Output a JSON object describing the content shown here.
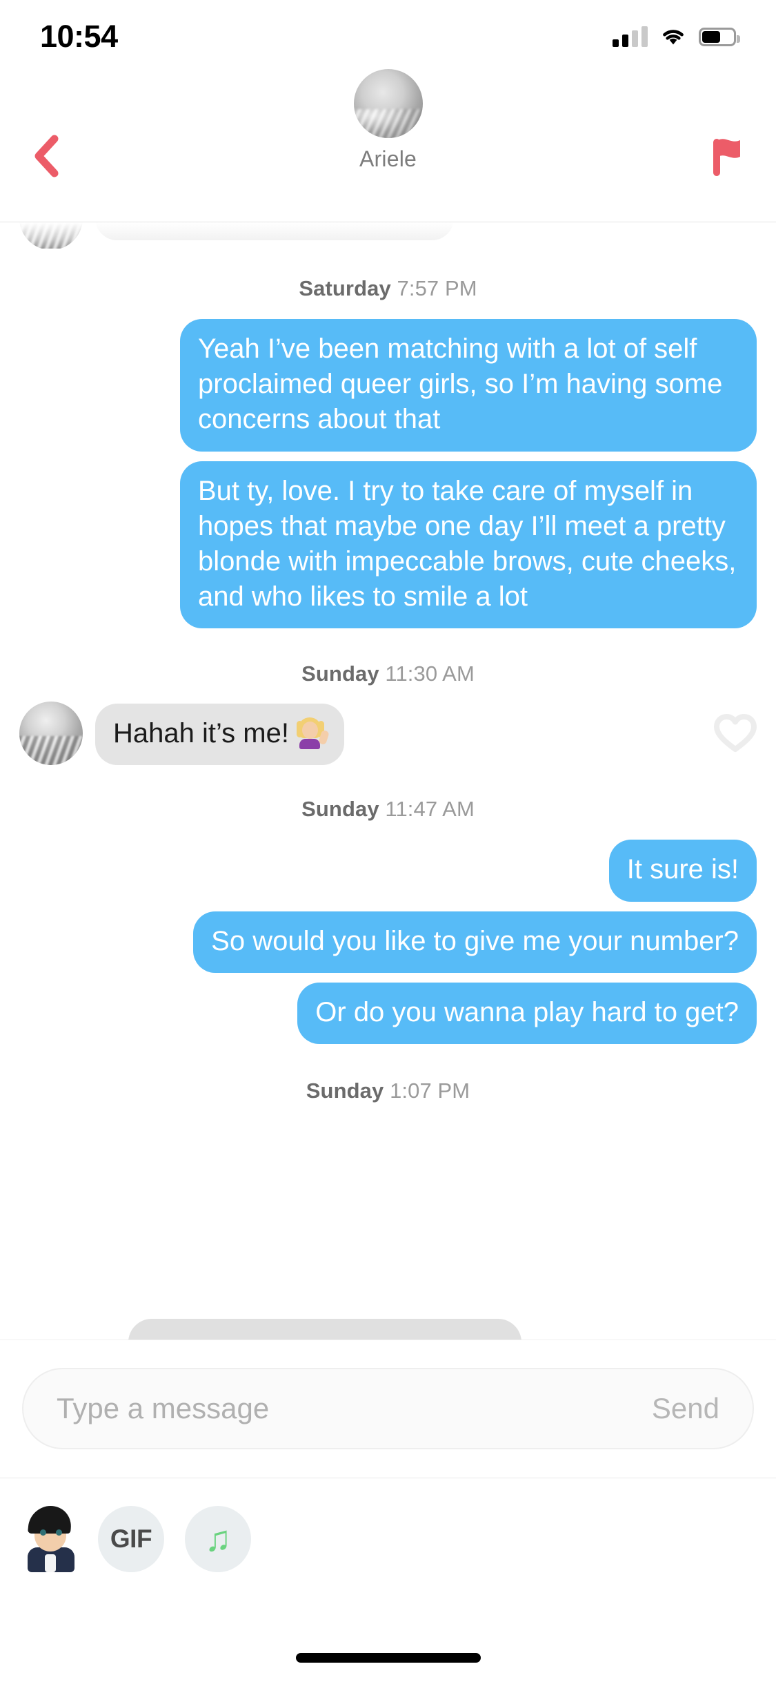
{
  "status_bar": {
    "time": "10:54",
    "signal_icon": "cellular-signal-icon",
    "wifi_icon": "wifi-icon",
    "battery_icon": "battery-icon",
    "battery_level_percent": 55
  },
  "header": {
    "back_icon": "chevron-left-icon",
    "report_icon": "flag-icon",
    "avatar_icon": "match-avatar",
    "name": "Ariele",
    "accent_color": "#ec5c68"
  },
  "thread": {
    "bubble_out_color": "#57bbf7",
    "bubble_in_color": "#e4e4e4",
    "groups": [
      {
        "day": "Saturday",
        "time": "7:57 PM",
        "messages": [
          {
            "side": "out",
            "text": "Yeah I’ve been matching with a lot of self proclaimed queer girls, so I’m having some concerns about that"
          },
          {
            "side": "out",
            "text": "But ty, love. I try to take care of myself in hopes that maybe one day I’ll meet a pretty blonde with impeccable brows, cute cheeks, and who likes to smile a lot"
          }
        ]
      },
      {
        "day": "Sunday",
        "time": "11:30 AM",
        "messages": [
          {
            "side": "in",
            "text": "Hahah it’s me!",
            "emoji": "💁‍♀️",
            "has_avatar": true,
            "like_icon": "heart-outline-icon"
          }
        ]
      },
      {
        "day": "Sunday",
        "time": "11:47 AM",
        "messages": [
          {
            "side": "out",
            "text": "It sure is!"
          },
          {
            "side": "out",
            "text": "So would you like to give me your number?"
          },
          {
            "side": "out",
            "text": "Or do you wanna play hard to get?"
          }
        ]
      },
      {
        "day": "Sunday",
        "time": "1:07 PM",
        "messages": []
      }
    ]
  },
  "composer": {
    "placeholder": "Type a message",
    "value": "",
    "send_label": "Send"
  },
  "toolbar": {
    "bitmoji_icon": "bitmoji-avatar-icon",
    "gif_label": "GIF",
    "gif_icon": "gif-icon",
    "music_icon": "music-note-icon",
    "music_glyph": "♫",
    "music_color": "#6ad37f"
  }
}
